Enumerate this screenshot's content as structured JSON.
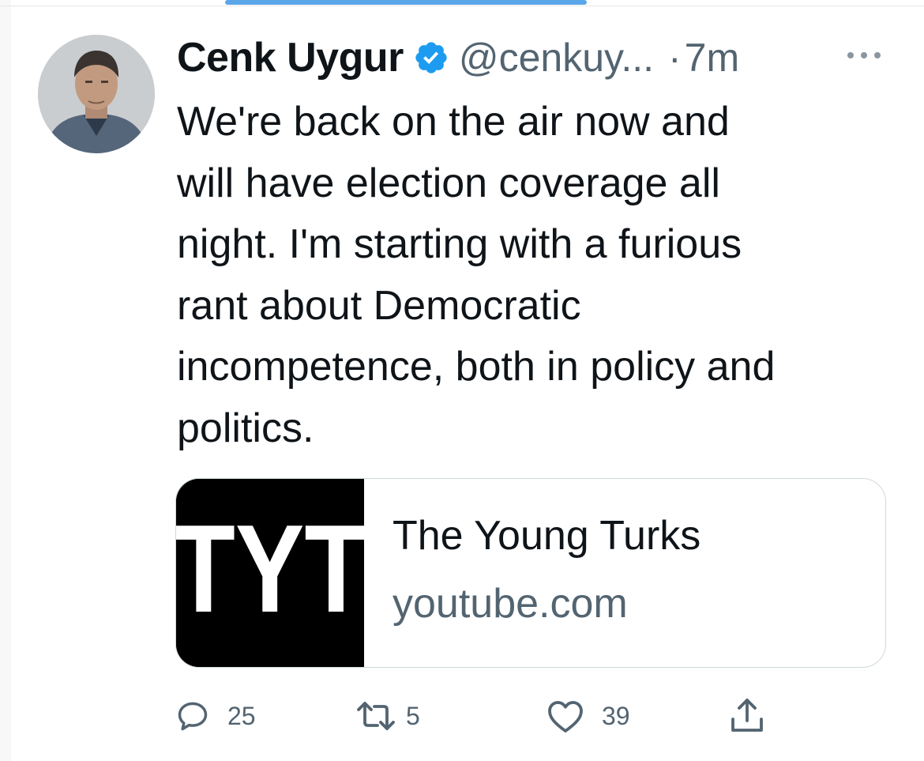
{
  "tweet": {
    "author_name": "Cenk Uygur",
    "handle": "@cenkuy...",
    "separator": "·",
    "time": "7m",
    "verified": true,
    "text": "We're back on the air now and\nwill have election coverage all\nnight. I'm starting with a furious\nrant about Democratic\nincompetence, both in policy and\npolitics."
  },
  "card": {
    "thumb_text": "TYT",
    "title": "The Young Turks",
    "domain": "youtube.com"
  },
  "actions": {
    "replies": "25",
    "retweets": "5",
    "likes": "39"
  },
  "colors": {
    "accent": "#1d9bf0",
    "muted": "#536471",
    "text": "#0f1419",
    "border": "#cfd9de"
  },
  "icons": {
    "verified": "verified-badge-icon",
    "more": "more-dots-icon",
    "reply": "reply-bubble-icon",
    "retweet": "retweet-icon",
    "like": "heart-icon",
    "share": "share-upload-icon"
  }
}
